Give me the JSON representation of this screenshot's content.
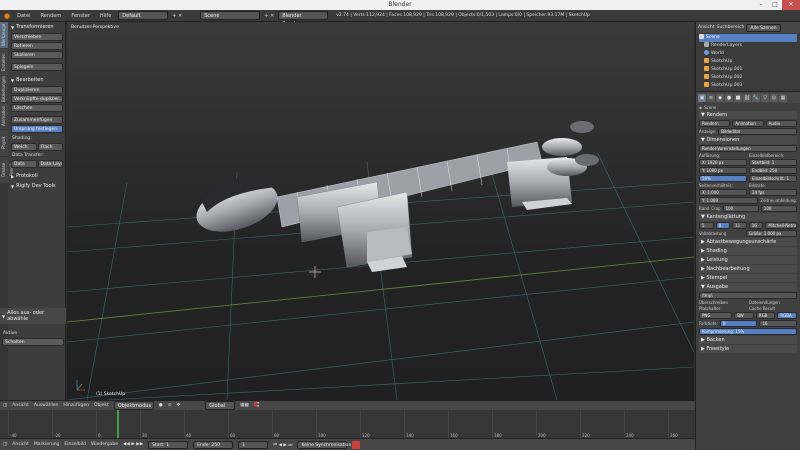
{
  "window": {
    "title": "Blender"
  },
  "infobar": {
    "menus": [
      "Datei",
      "Rendern",
      "Fenster",
      "Hilfe"
    ],
    "layout": "Default",
    "scene": "Scene",
    "engine": "Blender Renderer",
    "stats": "v2.74 | Verts:112,924 | Faces:108,929 | Tris:108,929 | Objects:0/1,503 | Lamps:0/0 | Speicher:93.17M | SketchUp"
  },
  "toolshelf": {
    "tabs": [
      "Werkzeuge",
      "Erstellen",
      "Beziehungen",
      "Animation",
      "Physik",
      "Grease Pencil"
    ],
    "transform": {
      "header": "Transformieren",
      "buttons": [
        "Verschieben",
        "Rotieren",
        "Skalieren",
        "Spiegeln"
      ]
    },
    "edit": {
      "header": "Bearbeiten",
      "buttons": [
        "Duplizieren",
        "Verknüpfte duplizier...",
        "Löschen",
        "Zusammenfügen",
        "Ursprung festlegen"
      ]
    },
    "shading": {
      "label": "Shading:",
      "buttons": [
        "Weich",
        "Flach"
      ]
    },
    "data_transfer": {
      "label": "Data Transfer:",
      "buttons": [
        "Data",
        "Data Lays"
      ]
    },
    "protokoll": "Protokoll",
    "rigify": "Rigify Dev Tools",
    "operator": {
      "header": "Alles aus- oder abwähle",
      "action_label": "Aktion",
      "action_value": "Schalten"
    }
  },
  "viewport": {
    "label": "Benutzer-Perspektive",
    "object": "(1) SketchUp"
  },
  "outliner": {
    "header": [
      "Ansicht",
      "Suchbereich",
      "Alle Szenen"
    ],
    "items": [
      "Scene",
      "RenderLayers",
      "World",
      "SketchUp",
      "SketchUp.001",
      "SketchUp.002",
      "SketchUp.003"
    ]
  },
  "properties": {
    "scene": "Scene",
    "render": {
      "header": "Rendern",
      "buttons": [
        "Rendern",
        "Animation",
        "Audio"
      ],
      "display_label": "Anzeige:",
      "display_value": "Bildeditor"
    },
    "dimensions": {
      "header": "Dimensionen",
      "preset": "Render-Voreinstellungen",
      "resolution_label": "Auflösung:",
      "res_x": "X: 1920 px",
      "res_y": "Y: 1080 px",
      "percent": "50%",
      "frame_range_label": "Einzelbildbereich:",
      "start": "Startbild: 1",
      "end": "Endbild: 250",
      "step": "Einzelbildschritt: 1",
      "aspect_label": "Seitenverhältnis:",
      "aspect_x": "X: 1.000",
      "aspect_y": "Y: 1.000",
      "fps_label": "Bildrate:",
      "fps": "24 fps",
      "time_label": "Zeitneuabbildung:",
      "time_old": "100",
      "time_new": "100",
      "border": "Rand",
      "crop": "Crop"
    },
    "aa": {
      "header": "Kantenglättung",
      "samples": [
        "5",
        "8",
        "11",
        "16"
      ],
      "filter": "Mitchell-Netravali",
      "full_sample": "Vollabtastung",
      "size": "Größe: 1.000 px"
    },
    "collapsed": [
      "Abtastbewegungsunschärfe",
      "Shading",
      "Leistung",
      "Nachbearbeitung",
      "Stempel"
    ],
    "output": {
      "header": "Ausgabe",
      "path": "/tmp\\",
      "overwrite": "Überschreiben",
      "extensions": "Dateiendungen",
      "placeholder": "Platzhalter",
      "cache": "Cache Result",
      "format": "PNG",
      "color_modes": [
        "BW",
        "RGB",
        "RGBA"
      ],
      "depth_label": "Farbtiefe:",
      "depth_values": [
        "8",
        "16"
      ],
      "compression": "Komprimierung: 15%"
    },
    "bake": "Backen",
    "freestyle": "Freestyle"
  },
  "timeline": {
    "menus": [
      "Ansicht",
      "Auswählen",
      "Hinzufügen",
      "Objekt"
    ],
    "mode": "Objektmodus",
    "orientation": "Global",
    "ticks": [
      "-40",
      "-20",
      "0",
      "20",
      "40",
      "60",
      "80",
      "100",
      "120",
      "140",
      "160",
      "180",
      "200",
      "220",
      "240",
      "260"
    ]
  },
  "bottombar": {
    "menus": [
      "Ansicht",
      "Markierung",
      "Einzelbild",
      "Wiedergabe"
    ],
    "start": "Start: 1",
    "end": "Ende: 250",
    "current": "1",
    "sync": "Keine Synchronisation"
  },
  "colors": {
    "accent": "#5680c2",
    "rec": "#c84040"
  }
}
